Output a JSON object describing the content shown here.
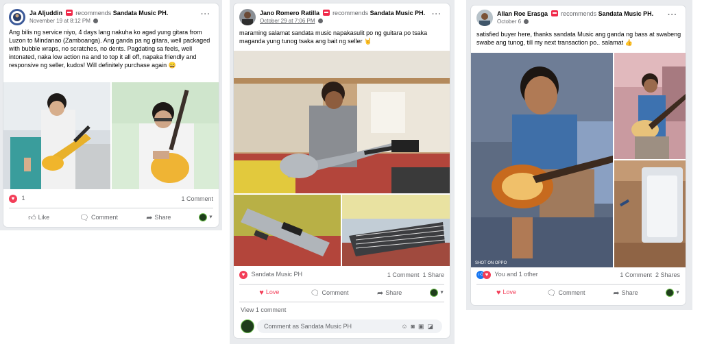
{
  "posts": [
    {
      "author": "Ja Aljuddin",
      "recommends_word": "recommends",
      "page": "Sandata Music PH.",
      "date": "November 19 at 8:12 PM",
      "text": "Ang bilis ng service niyo, 4 days lang nakuha ko agad yung gitara from Luzon to Mindanao (Zamboanga). Ang ganda pa ng gitara, well packaged with bubble wraps, no scratches, no dents. Pagdating sa feels, well intonated, naka low action na and to top it all off, napaka friendly and responsive ng seller, kudos! Will definitely purchase again 😀",
      "reactions": "1",
      "comments": "1 Comment",
      "actions": [
        "Like",
        "Comment",
        "Share"
      ]
    },
    {
      "author": "Jano Romero Ratilla",
      "recommends_word": "recommends",
      "page": "Sandata Music PH.",
      "date": "October 29 at 7:06 PM",
      "text": "maraming salamat sandata music napakasulit po ng guitara po tsaka maganda yung tunog tsaka ang bait ng seller 🤘",
      "reactions": "Sandata Music PH",
      "comments": "1 Comment",
      "shares": "1 Share",
      "actions": [
        "Love",
        "Comment",
        "Share"
      ],
      "view_comments": "View 1 comment",
      "comment_placeholder": "Comment as Sandata Music PH"
    },
    {
      "author": "Allan Roe Erasga",
      "recommends_word": "recommends",
      "page": "Sandata Music PH.",
      "date": "October 6",
      "text": "satisfied buyer here,  thanks sandata Music ang ganda ng bass at swabeng swabe ang tunog,  till my next transaction  po.. salamat 👍",
      "reactions": "You and 1 other",
      "comments": "1 Comment",
      "shares": "2 Shares",
      "actions": [
        "Love",
        "Comment",
        "Share"
      ],
      "watermark": "SHOT ON OPPO"
    }
  ],
  "colors": {
    "love": "#f33e58",
    "like": "#1877f2",
    "muted": "#65676b",
    "brand_avatar": "#1f3d1c"
  },
  "icons": [
    "recommend-icon",
    "globe-icon",
    "more-icon",
    "heart-icon",
    "like-icon",
    "comment-icon",
    "share-icon",
    "emoji-icon",
    "camera-icon",
    "gif-icon",
    "sticker-icon"
  ]
}
